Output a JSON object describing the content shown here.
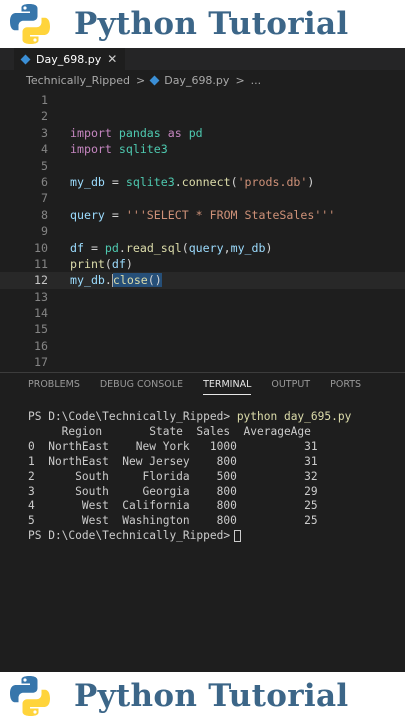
{
  "banner": {
    "title": "Python Tutorial",
    "logo_icon": "python-logo-icon"
  },
  "colors": {
    "banner_title": "#3c6688",
    "python_blue": "#3776ab",
    "python_yellow": "#ffd43b",
    "accent": "#3b8fd6"
  },
  "editor": {
    "tab": {
      "label": "Day_698.py",
      "close": "✕"
    },
    "breadcrumb": {
      "folder": "Technically_Ripped",
      "sep": ">",
      "file": "Day_698.py",
      "more": "..."
    },
    "line_numbers": [
      "1",
      "2",
      "3",
      "4",
      "5",
      "6",
      "7",
      "8",
      "9",
      "10",
      "11",
      "12",
      "13",
      "14",
      "15",
      "16",
      "17"
    ],
    "code": {
      "l3": {
        "kw": "import",
        "a": " ",
        "mod": "pandas",
        "b": " ",
        "kw2": "as",
        "c": " ",
        "mod2": "pd"
      },
      "l4": {
        "kw": "import",
        "a": " ",
        "mod": "sqlite3"
      },
      "l6": {
        "var": "my_db",
        "a": " = ",
        "mod": "sqlite3",
        "b": ".",
        "fn": "connect",
        "c": "(",
        "str": "'prods.db'",
        "d": ")"
      },
      "l8": {
        "var": "query",
        "a": " = ",
        "str": "'''SELECT * FROM StateSales'''"
      },
      "l10": {
        "var": "df",
        "a": " = ",
        "mod": "pd",
        "b": ".",
        "fn": "read_sql",
        "c": "(",
        "var2": "query",
        "d": ",",
        "var3": "my_db",
        "e": ")"
      },
      "l11": {
        "fn": "print",
        "a": "(",
        "var": "df",
        "b": ")"
      },
      "l12": {
        "var": "my_db",
        "a": ".",
        "fn": "close",
        "b": "()"
      }
    }
  },
  "panel": {
    "tabs": [
      "PROBLEMS",
      "DEBUG CONSOLE",
      "TERMINAL",
      "OUTPUT",
      "PORTS"
    ],
    "active_tab": "TERMINAL",
    "terminal": {
      "prompt": "PS D:\\Code\\Technically_Ripped> ",
      "command": "python day_695.py",
      "header": "     Region       State  Sales  AverageAge",
      "rows": [
        "0  NorthEast    New York   1000          31",
        "1  NorthEast  New Jersey    800          31",
        "2      South     Florida    500          32",
        "3      South     Georgia    800          29",
        "4       West  California    800          25",
        "5       West  Washington    800          25"
      ],
      "final_prompt": "PS D:\\Code\\Technically_Ripped>"
    }
  }
}
